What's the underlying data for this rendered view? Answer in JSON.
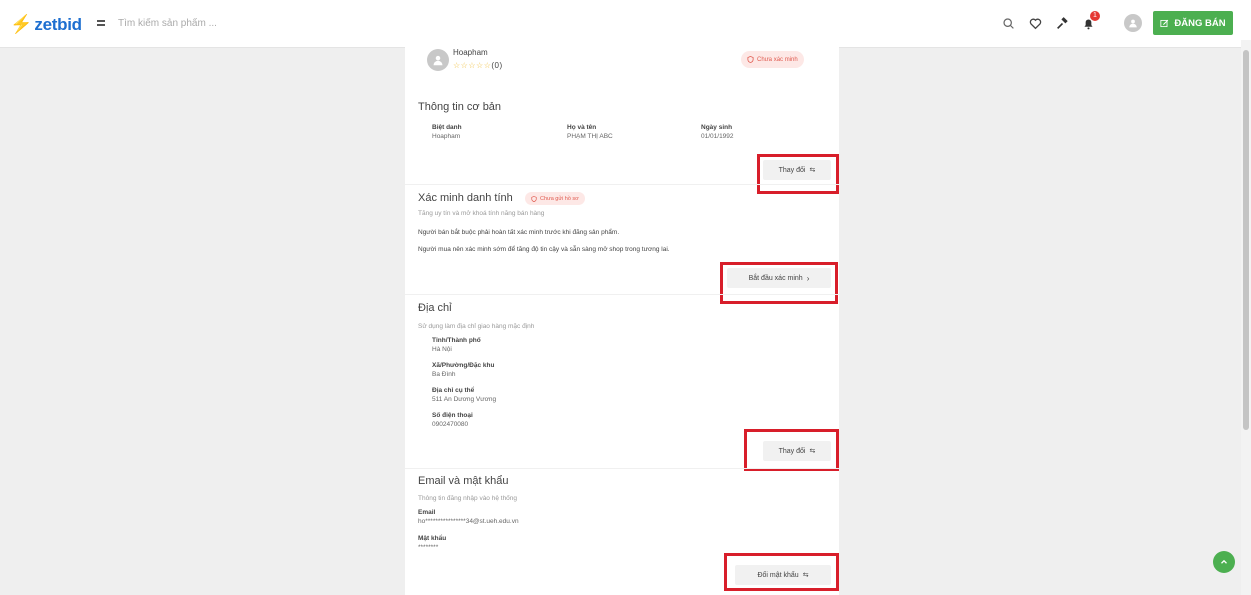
{
  "app": {
    "logo_text": "zetbid"
  },
  "header": {
    "search": {
      "placeholder": "Tìm kiếm sản phẩm ...",
      "value": ""
    },
    "notification_count": "1",
    "sell_button": "ĐĂNG BÁN"
  },
  "profile": {
    "name": "Hoapham",
    "stars": "☆☆☆☆☆",
    "review_count": "(0)",
    "status": "Chưa xác minh"
  },
  "basic_info": {
    "title": "Thông tin cơ bản",
    "fields": [
      {
        "label": "Biệt danh",
        "value": "Hoapham"
      },
      {
        "label": "Họ và tên",
        "value": "PHẠM THỊ ABC"
      },
      {
        "label": "Ngày sinh",
        "value": "01/01/1992"
      }
    ],
    "change_button": "Thay đổi"
  },
  "identity": {
    "title": "Xác minh danh tính",
    "status": "Chưa gửi hồ sơ",
    "subtitle": "Tăng uy tín và mở khoá tính năng bán hàng",
    "note_seller": "Người bán bắt buộc phải hoàn tất xác minh trước khi đăng sản phẩm.",
    "note_buyer": "Người mua nên xác minh sớm để tăng độ tin cậy và sẵn sàng mở shop trong tương lai.",
    "start_button": "Bắt đầu xác minh"
  },
  "address": {
    "title": "Địa chỉ",
    "subtitle": "Sử dụng làm địa chỉ giao hàng mặc định",
    "fields": [
      {
        "label": "Tỉnh/Thành phố",
        "value": "Hà Nội"
      },
      {
        "label": "Xã/Phường/Đặc khu",
        "value": "Ba Đình"
      },
      {
        "label": "Địa chỉ cụ thể",
        "value": "511 An Dương Vương"
      },
      {
        "label": "Số điện thoại",
        "value": "0902470080"
      }
    ],
    "change_button": "Thay đổi"
  },
  "account": {
    "title": "Email và mật khẩu",
    "subtitle": "Thông tin đăng nhập vào hệ thống",
    "fields": [
      {
        "label": "Email",
        "value": "ho****************34@st.ueh.edu.vn"
      },
      {
        "label": "Mật khẩu",
        "value": "********"
      }
    ],
    "change_password_button": "Đổi mật khẩu"
  },
  "colors": {
    "accent_green": "#4caf50",
    "brand_blue": "#1e6fd0",
    "highlight_red": "#d81e2a",
    "status_red": "#e05a4f"
  },
  "icons": [
    "menu-icon",
    "search-icon",
    "heart-icon",
    "hammer-icon",
    "bell-icon",
    "user-icon",
    "edit-icon",
    "shield-icon",
    "swap-icon",
    "chevron-right-icon",
    "arrow-up-icon"
  ]
}
